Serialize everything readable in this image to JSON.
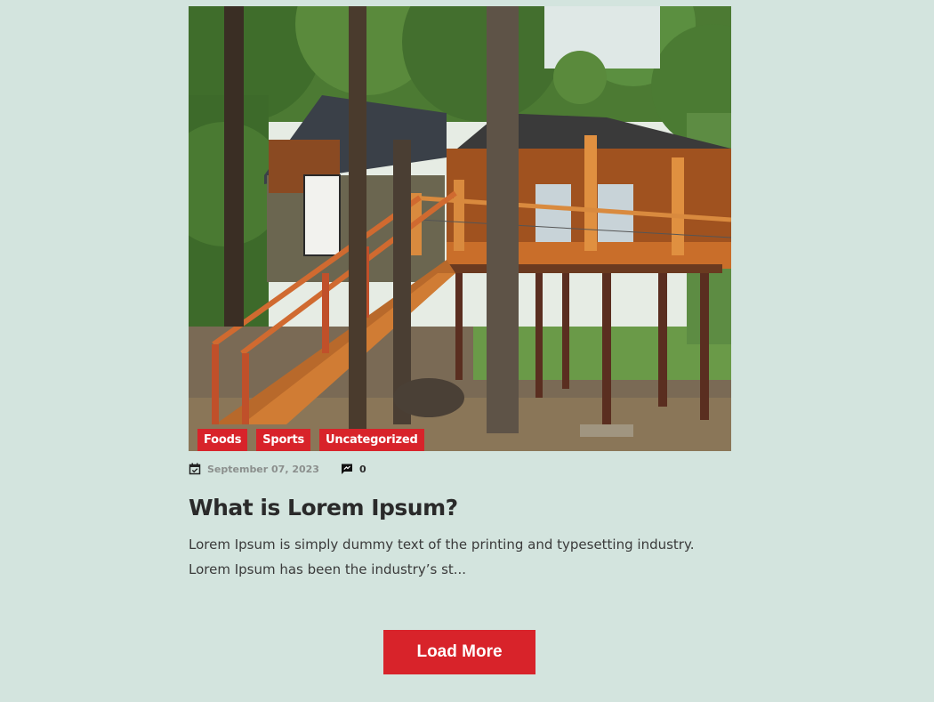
{
  "post": {
    "image_alt": "Treehouse cabin with wooden staircase among trees",
    "categories": [
      {
        "label": "Foods"
      },
      {
        "label": "Sports"
      },
      {
        "label": "Uncategorized"
      }
    ],
    "meta": {
      "date": "September 07, 2023",
      "date_icon": "calendar-check-icon",
      "comments": "0",
      "comments_icon": "comment-icon"
    },
    "title": "What is Lorem Ipsum?",
    "excerpt": "Lorem Ipsum is simply dummy text of the printing and typesetting industry. Lorem Ipsum has been the industry’s st..."
  },
  "pagination": {
    "load_more_label": "Load More"
  },
  "colors": {
    "background": "#d3e4de",
    "accent": "#d8232a",
    "title": "#2a2a2a",
    "meta_date": "#8b8f8d"
  }
}
